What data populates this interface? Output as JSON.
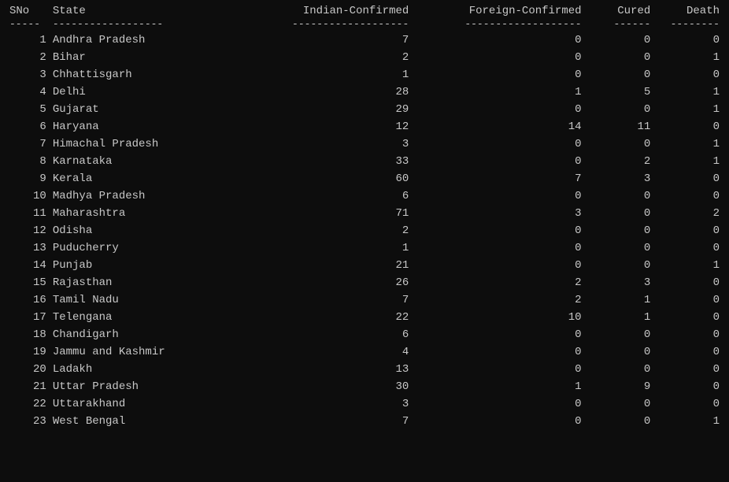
{
  "table": {
    "headers": {
      "sno": "SNo",
      "state": "State",
      "indian_confirmed": "Indian-Confirmed",
      "foreign_confirmed": "Foreign-Confirmed",
      "cured": "Cured",
      "death": "Death"
    },
    "separators": {
      "sno": "-----",
      "state": "------------------",
      "indian_confirmed": "-------------------",
      "foreign_confirmed": "-------------------",
      "cured": "------",
      "death": "--------"
    },
    "rows": [
      {
        "sno": "1",
        "state": "Andhra Pradesh",
        "indian": "7",
        "foreign": "0",
        "cured": "0",
        "death": "0"
      },
      {
        "sno": "2",
        "state": "Bihar",
        "indian": "2",
        "foreign": "0",
        "cured": "0",
        "death": "1"
      },
      {
        "sno": "3",
        "state": "Chhattisgarh",
        "indian": "1",
        "foreign": "0",
        "cured": "0",
        "death": "0"
      },
      {
        "sno": "4",
        "state": "Delhi",
        "indian": "28",
        "foreign": "1",
        "cured": "5",
        "death": "1"
      },
      {
        "sno": "5",
        "state": "Gujarat",
        "indian": "29",
        "foreign": "0",
        "cured": "0",
        "death": "1"
      },
      {
        "sno": "6",
        "state": "Haryana",
        "indian": "12",
        "foreign": "14",
        "cured": "11",
        "death": "0"
      },
      {
        "sno": "7",
        "state": "Himachal Pradesh",
        "indian": "3",
        "foreign": "0",
        "cured": "0",
        "death": "1"
      },
      {
        "sno": "8",
        "state": "Karnataka",
        "indian": "33",
        "foreign": "0",
        "cured": "2",
        "death": "1"
      },
      {
        "sno": "9",
        "state": "Kerala",
        "indian": "60",
        "foreign": "7",
        "cured": "3",
        "death": "0"
      },
      {
        "sno": "10",
        "state": "Madhya Pradesh",
        "indian": "6",
        "foreign": "0",
        "cured": "0",
        "death": "0"
      },
      {
        "sno": "11",
        "state": "Maharashtra",
        "indian": "71",
        "foreign": "3",
        "cured": "0",
        "death": "2"
      },
      {
        "sno": "12",
        "state": "Odisha",
        "indian": "2",
        "foreign": "0",
        "cured": "0",
        "death": "0"
      },
      {
        "sno": "13",
        "state": "Puducherry",
        "indian": "1",
        "foreign": "0",
        "cured": "0",
        "death": "0"
      },
      {
        "sno": "14",
        "state": "Punjab",
        "indian": "21",
        "foreign": "0",
        "cured": "0",
        "death": "1"
      },
      {
        "sno": "15",
        "state": "Rajasthan",
        "indian": "26",
        "foreign": "2",
        "cured": "3",
        "death": "0"
      },
      {
        "sno": "16",
        "state": "Tamil Nadu",
        "indian": "7",
        "foreign": "2",
        "cured": "1",
        "death": "0"
      },
      {
        "sno": "17",
        "state": "Telengana",
        "indian": "22",
        "foreign": "10",
        "cured": "1",
        "death": "0"
      },
      {
        "sno": "18",
        "state": "Chandigarh",
        "indian": "6",
        "foreign": "0",
        "cured": "0",
        "death": "0"
      },
      {
        "sno": "19",
        "state": "Jammu and Kashmir",
        "indian": "4",
        "foreign": "0",
        "cured": "0",
        "death": "0"
      },
      {
        "sno": "20",
        "state": "Ladakh",
        "indian": "13",
        "foreign": "0",
        "cured": "0",
        "death": "0"
      },
      {
        "sno": "21",
        "state": "Uttar Pradesh",
        "indian": "30",
        "foreign": "1",
        "cured": "9",
        "death": "0"
      },
      {
        "sno": "22",
        "state": "Uttarakhand",
        "indian": "3",
        "foreign": "0",
        "cured": "0",
        "death": "0"
      },
      {
        "sno": "23",
        "state": "West Bengal",
        "indian": "7",
        "foreign": "0",
        "cured": "0",
        "death": "1"
      }
    ]
  }
}
